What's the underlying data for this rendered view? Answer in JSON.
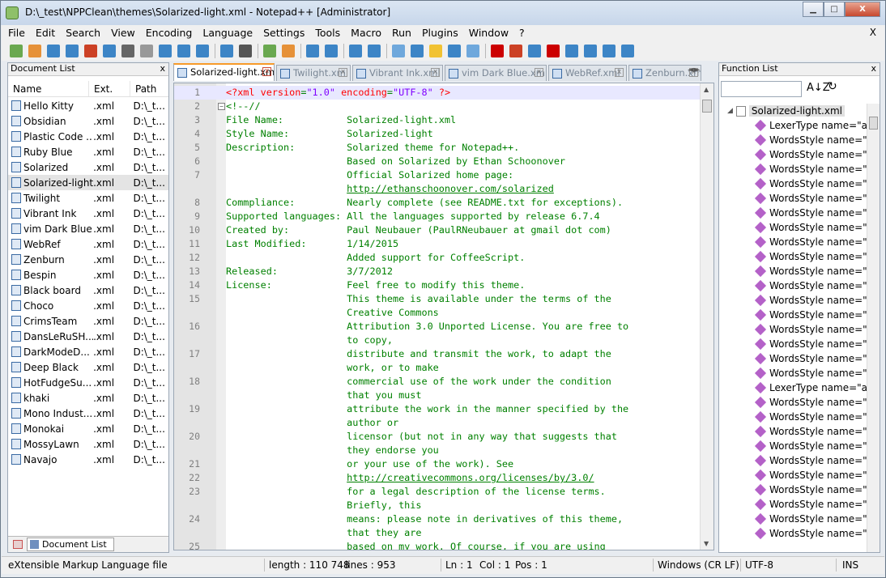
{
  "window": {
    "title": "D:\\_test\\NPPClean\\themes\\Solarized-light.xml - Notepad++ [Administrator]",
    "minimize_glyph": "▁",
    "maximize_glyph": "□",
    "close_glyph": "X"
  },
  "menu": {
    "items": [
      "File",
      "Edit",
      "Search",
      "View",
      "Encoding",
      "Language",
      "Settings",
      "Tools",
      "Macro",
      "Run",
      "Plugins",
      "Window",
      "?"
    ],
    "close_glyph": "X"
  },
  "doc_list": {
    "title": "Document List",
    "close_glyph": "x",
    "columns": [
      "Name",
      "Ext.",
      "Path"
    ],
    "rows": [
      {
        "name": "Hello Kitty",
        "ext": ".xml",
        "path": "D:\\_t..."
      },
      {
        "name": "Obsidian",
        "ext": ".xml",
        "path": "D:\\_t..."
      },
      {
        "name": "Plastic Code ...",
        "ext": ".xml",
        "path": "D:\\_t..."
      },
      {
        "name": "Ruby Blue",
        "ext": ".xml",
        "path": "D:\\_t..."
      },
      {
        "name": "Solarized",
        "ext": ".xml",
        "path": "D:\\_t..."
      },
      {
        "name": "Solarized-light",
        "ext": ".xml",
        "path": "D:\\_t..."
      },
      {
        "name": "Twilight",
        "ext": ".xml",
        "path": "D:\\_t..."
      },
      {
        "name": "Vibrant Ink",
        "ext": ".xml",
        "path": "D:\\_t..."
      },
      {
        "name": "vim Dark Blue",
        "ext": ".xml",
        "path": "D:\\_t..."
      },
      {
        "name": "WebRef",
        "ext": ".xml",
        "path": "D:\\_t..."
      },
      {
        "name": "Zenburn",
        "ext": ".xml",
        "path": "D:\\_t..."
      },
      {
        "name": "Bespin",
        "ext": ".xml",
        "path": "D:\\_t..."
      },
      {
        "name": "Black board",
        "ext": ".xml",
        "path": "D:\\_t..."
      },
      {
        "name": "Choco",
        "ext": ".xml",
        "path": "D:\\_t..."
      },
      {
        "name": "CrimsTeam",
        "ext": ".xml",
        "path": "D:\\_t..."
      },
      {
        "name": "DansLeRuSH...",
        "ext": ".xml",
        "path": "D:\\_t..."
      },
      {
        "name": "DarkModeD...",
        "ext": ".xml",
        "path": "D:\\_t..."
      },
      {
        "name": "Deep Black",
        "ext": ".xml",
        "path": "D:\\_t..."
      },
      {
        "name": "HotFudgeSu...",
        "ext": ".xml",
        "path": "D:\\_t..."
      },
      {
        "name": "khaki",
        "ext": ".xml",
        "path": "D:\\_t..."
      },
      {
        "name": "Mono Indust...",
        "ext": ".xml",
        "path": "D:\\_t..."
      },
      {
        "name": "Monokai",
        "ext": ".xml",
        "path": "D:\\_t..."
      },
      {
        "name": "MossyLawn",
        "ext": ".xml",
        "path": "D:\\_t..."
      },
      {
        "name": "Navajo",
        "ext": ".xml",
        "path": "D:\\_t..."
      }
    ],
    "selected_index": 5,
    "bottom_tab": "Document List"
  },
  "tabs": [
    {
      "label": "Solarized-light.xml",
      "active": true
    },
    {
      "label": "Twilight.xml",
      "active": false
    },
    {
      "label": "Vibrant Ink.xml",
      "active": false
    },
    {
      "label": "vim Dark Blue.xml",
      "active": false
    },
    {
      "label": "WebRef.xml",
      "active": false
    },
    {
      "label": "Zenburn.xml",
      "active": false
    }
  ],
  "tab_close_glyph": "x",
  "tab_scroll": "◄►",
  "editor": {
    "fold_glyph": "−",
    "lines": [
      {
        "n": "1",
        "html": "<span class='pi'>&lt;?xml</span> <span class='attr'>version</span>=<span class='val'>\"1.0\"</span> <span class='attr'>encoding</span>=<span class='val'>\"UTF-8\"</span> <span class='pi'>?&gt;</span>"
      },
      {
        "n": "2",
        "text": "<!--//"
      },
      {
        "n": "3",
        "text": "File Name:           Solarized-light.xml"
      },
      {
        "n": "4",
        "text": "Style Name:          Solarized-light"
      },
      {
        "n": "5",
        "text": "Description:         Solarized theme for Notepad++."
      },
      {
        "n": "6",
        "text": "                     Based on Solarized by Ethan Schoonover"
      },
      {
        "n": "7",
        "text": "                     Official Solarized home page:"
      },
      {
        "n": "",
        "url": "http://ethanschoonover.com/solarized",
        "indent": "                     "
      },
      {
        "n": "8",
        "text": "Commpliance:         Nearly complete (see README.txt for exceptions)."
      },
      {
        "n": "9",
        "text": "Supported languages: All the languages supported by release 6.7.4"
      },
      {
        "n": "10",
        "text": "Created by:          Paul Neubauer (PaulRNeubauer at gmail dot com)"
      },
      {
        "n": "11",
        "text": "Last Modified:       1/14/2015"
      },
      {
        "n": "12",
        "text": "                     Added support for CoffeeScript."
      },
      {
        "n": "13",
        "text": "Released:            3/7/2012"
      },
      {
        "n": "14",
        "text": "License:             Feel free to modify this theme."
      },
      {
        "n": "15",
        "text": "                     This theme is available under the terms of the"
      },
      {
        "n": "",
        "text": "                     Creative Commons"
      },
      {
        "n": "16",
        "text": "                     Attribution 3.0 Unported License. You are free to"
      },
      {
        "n": "",
        "text": "                     to copy,"
      },
      {
        "n": "17",
        "text": "                     distribute and transmit the work, to adapt the"
      },
      {
        "n": "",
        "text": "                     work, or to make"
      },
      {
        "n": "18",
        "text": "                     commercial use of the work under the condition"
      },
      {
        "n": "",
        "text": "                     that you must"
      },
      {
        "n": "19",
        "text": "                     attribute the work in the manner specified by the"
      },
      {
        "n": "",
        "text": "                     author or"
      },
      {
        "n": "20",
        "text": "                     licensor (but not in any way that suggests that"
      },
      {
        "n": "",
        "text": "                     they endorse you"
      },
      {
        "n": "21",
        "text": "                     or your use of the work). See"
      },
      {
        "n": "22",
        "url": "http://creativecommons.org/licenses/by/3.0/",
        "indent": "                     "
      },
      {
        "n": "23",
        "text": "                     for a legal description of the license terms."
      },
      {
        "n": "",
        "text": "                     Briefly, this"
      },
      {
        "n": "24",
        "text": "                     means: please note in derivatives of this theme,"
      },
      {
        "n": "",
        "text": "                     that they are"
      },
      {
        "n": "25",
        "text": "                     based on my work. Of course, if you are using"
      }
    ]
  },
  "function_list": {
    "title": "Function List",
    "close_glyph": "x",
    "sort_glyph": "A↓Z",
    "reload_glyph": "↻",
    "root": "Solarized-light.xml",
    "items": [
      "LexerType name=\"acti",
      "WordsStyle name=\"DE",
      "WordsStyle name=\"FU",
      "WordsStyle name=\"PR",
      "WordsStyle name=\"INS",
      "WordsStyle name=\"TY",
      "WordsStyle name=\"NU",
      "WordsStyle name=\"ST",
      "WordsStyle name=\"CH",
      "WordsStyle name=\"OP",
      "WordsStyle name=\"VE",
      "WordsStyle name=\"RE",
      "WordsStyle name=\"CO",
      "WordsStyle name=\"CO",
      "WordsStyle name=\"CO",
      "WordsStyle name=\"CO",
      "WordsStyle name=\"CO",
      "WordsStyle name=\"CO",
      "LexerType name=\"ada",
      "WordsStyle name=\"DE",
      "WordsStyle name=\"INS",
      "WordsStyle name=\"IDE",
      "WordsStyle name=\"NU",
      "WordsStyle name=\"DE",
      "WordsStyle name=\"CH",
      "WordsStyle name=\"CH",
      "WordsStyle name=\"ST",
      "WordsStyle name=\"ST",
      "WordsStyle name=\"LA"
    ]
  },
  "status": {
    "file_type": "eXtensible Markup Language file",
    "length": "length : 110 748",
    "lines": "lines : 953",
    "ln": "Ln : 1",
    "col": "Col : 1",
    "pos": "Pos : 1",
    "eol": "Windows (CR LF)",
    "encoding": "UTF-8",
    "mode": "INS"
  },
  "toolbar_colors": [
    "#6aa84f",
    "#e69138",
    "#3d85c6",
    "#3d85c6",
    "#cc4125",
    "#3d85c6",
    "#666666",
    "#999999",
    "#3d85c6",
    "#3d85c6",
    "#3d85c6",
    "#3d85c6",
    "#555555",
    "#6aa84f",
    "#e69138",
    "#3d85c6",
    "#3d85c6",
    "#3d85c6",
    "#3d85c6",
    "#6fa8dc",
    "#3d85c6",
    "#f1c232",
    "#3d85c6",
    "#6fa8dc",
    "#cc0000",
    "#cc4125",
    "#3d85c6",
    "#cc0000",
    "#3d85c6",
    "#3d85c6",
    "#3d85c6",
    "#3d85c6"
  ]
}
